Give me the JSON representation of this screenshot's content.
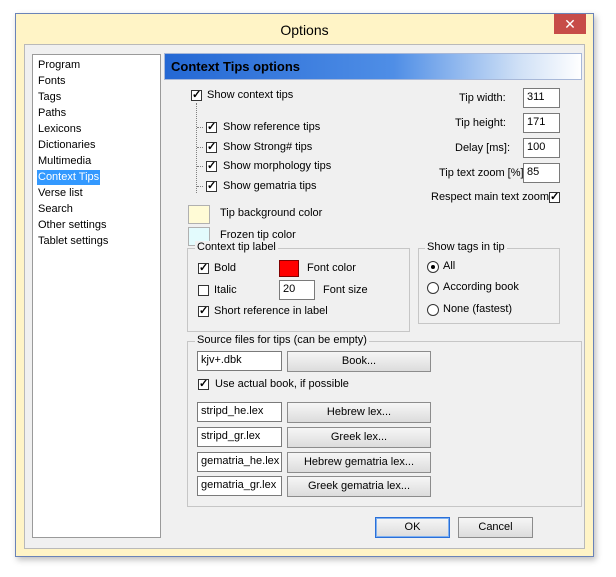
{
  "window": {
    "title": "Options",
    "close_label": "✕"
  },
  "sidebar": {
    "items": [
      {
        "label": "Program"
      },
      {
        "label": "Fonts"
      },
      {
        "label": "Tags"
      },
      {
        "label": "Paths"
      },
      {
        "label": "Lexicons"
      },
      {
        "label": "Dictionaries"
      },
      {
        "label": "Multimedia"
      },
      {
        "label": "Context Tips",
        "selected": true
      },
      {
        "label": "Verse list"
      },
      {
        "label": "Search"
      },
      {
        "label": "Other settings"
      },
      {
        "label": "Tablet settings"
      }
    ]
  },
  "header": {
    "title": "Context Tips options"
  },
  "tips": {
    "show_context": {
      "label": "Show context tips",
      "checked": true
    },
    "sub": [
      {
        "label": "Show reference tips",
        "checked": true
      },
      {
        "label": "Show Strong# tips",
        "checked": true
      },
      {
        "label": "Show morphology tips",
        "checked": true
      },
      {
        "label": "Show gematria tips",
        "checked": true
      }
    ],
    "tip_bg_label": "Tip background color",
    "tip_bg_color": "#fffbd6",
    "frozen_label": "Frozen tip color",
    "frozen_color": "#e3fbfd"
  },
  "fields": {
    "width_label": "Tip width:",
    "width_value": "311",
    "height_label": "Tip height:",
    "height_value": "171",
    "delay_label": "Delay [ms]:",
    "delay_value": "100",
    "zoom_label": "Tip text zoom [%]",
    "zoom_value": "85",
    "respect_label": "Respect main text zoom",
    "respect_checked": true
  },
  "context_label": {
    "group_title": "Context tip label",
    "bold_label": "Bold",
    "bold_checked": true,
    "font_color_label": "Font color",
    "font_color": "#ff0000",
    "italic_label": "Italic",
    "italic_checked": false,
    "font_size_value": "20",
    "font_size_label": "Font size",
    "short_ref_label": "Short reference in label",
    "short_ref_checked": true
  },
  "show_tags": {
    "group_title": "Show tags in tip",
    "options": [
      {
        "label": "All",
        "selected": true
      },
      {
        "label": "According book",
        "selected": false
      },
      {
        "label": "None (fastest)",
        "selected": false
      }
    ]
  },
  "sources": {
    "group_title": "Source files for tips (can be empty)",
    "book_value": "kjv+.dbk",
    "book_button": "Book...",
    "use_actual_label": "Use actual book, if possible",
    "use_actual_checked": true,
    "hebrew_value": "stripd_he.lex",
    "hebrew_button": "Hebrew lex...",
    "greek_value": "stripd_gr.lex",
    "greek_button": "Greek lex...",
    "hebrew_gem_value": "gematria_he.lex",
    "hebrew_gem_button": "Hebrew gematria lex...",
    "greek_gem_value": "gematria_gr.lex",
    "greek_gem_button": "Greek gematria lex..."
  },
  "footer": {
    "ok_label": "OK",
    "cancel_label": "Cancel"
  },
  "check_mark": "✓"
}
